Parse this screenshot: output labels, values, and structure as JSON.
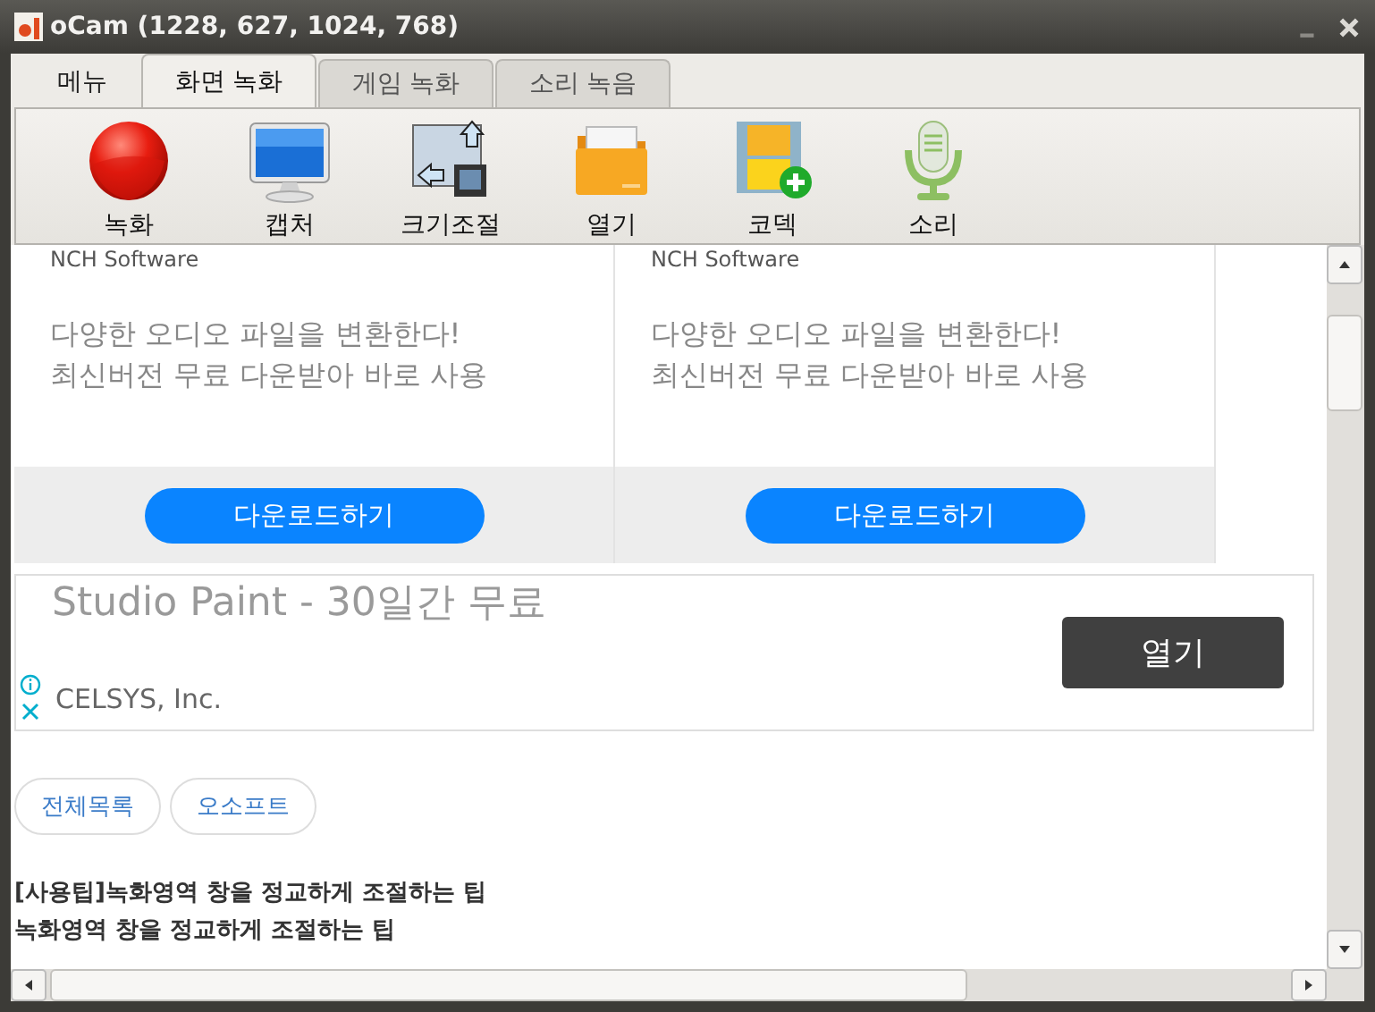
{
  "window": {
    "title": "oCam (1228, 627, 1024, 768)"
  },
  "menu_button": "메뉴",
  "tabs": [
    {
      "label": "화면 녹화",
      "selected": true
    },
    {
      "label": "게임 녹화",
      "selected": false
    },
    {
      "label": "소리 녹음",
      "selected": false
    }
  ],
  "toolbar": [
    {
      "kind": "record",
      "label": "녹화"
    },
    {
      "kind": "capture",
      "label": "캡처"
    },
    {
      "kind": "resize",
      "label": "크기조절"
    },
    {
      "kind": "open",
      "label": "열기"
    },
    {
      "kind": "codec",
      "label": "코덱"
    },
    {
      "kind": "sound",
      "label": "소리"
    }
  ],
  "ad_cards": [
    {
      "publisher": "NCH Software",
      "description": "다양한 오디오 파일을 변환한다!\n최신버전 무료 다운받아 바로 사용",
      "button": "다운로드하기"
    },
    {
      "publisher": "NCH Software",
      "description": "다양한 오디오 파일을 변환한다!\n최신버전 무료 다운받아 바로 사용",
      "button": "다운로드하기"
    }
  ],
  "banner_ad": {
    "title": "Studio Paint - 30일간 무료",
    "advertiser": "CELSYS, Inc.",
    "button": "열기"
  },
  "chips": [
    "전체목록",
    "오소프트"
  ],
  "tips": [
    "[사용팁]녹화영역 창을 정교하게 조절하는 팁",
    "녹화영역 창을 정교하게 조절하는 팁"
  ]
}
